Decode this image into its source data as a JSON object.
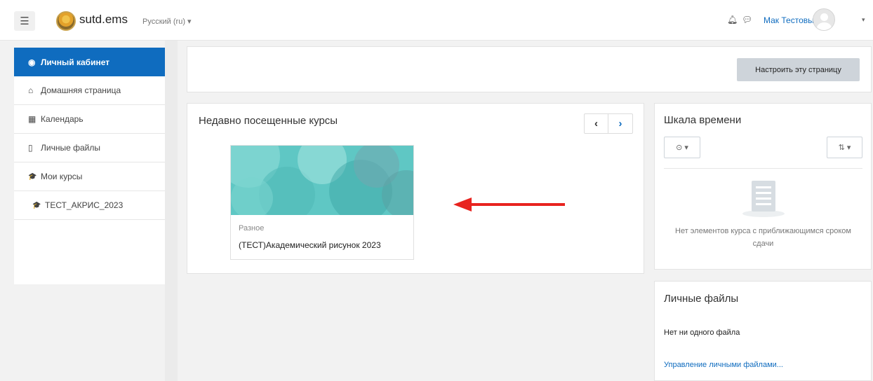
{
  "header": {
    "menu_icon": "hamburger-icon",
    "site_name": "sutd.ems",
    "language": "Русский (ru) ▾",
    "notification_icon": "bell-icon",
    "messages_icon": "chat-icon",
    "user_name": "Мак Тестовый",
    "user_menu_caret": "▾"
  },
  "sidebar": {
    "items": [
      {
        "label": "Личный кабинет",
        "icon": "dashboard-icon",
        "glyph": "◉",
        "active": true
      },
      {
        "label": "Домашняя страница",
        "icon": "home-icon",
        "glyph": "⌂"
      },
      {
        "label": "Календарь",
        "icon": "calendar-icon",
        "glyph": "▦"
      },
      {
        "label": "Личные файлы",
        "icon": "file-icon",
        "glyph": "▯"
      },
      {
        "label": "Мои курсы",
        "icon": "graduation-cap-icon",
        "glyph": "🎓"
      },
      {
        "label": "ТЕСТ_АКРИС_2023",
        "icon": "graduation-cap-icon",
        "glyph": "🎓"
      }
    ]
  },
  "main": {
    "customize_button": "Настроить эту страницу",
    "recent": {
      "title": "Недавно посещенные курсы",
      "prev": "‹",
      "next": "›",
      "course": {
        "category": "Разное",
        "name": "(ТЕСТ)Академический рисунок 2023"
      }
    }
  },
  "timeline": {
    "title": "Шкала времени",
    "filter_button": "⊙ ▾",
    "sort_button": "⇅ ▾",
    "empty_icon": "list-icon",
    "empty_text": "Нет элементов курса с приближающимся сроком сдачи"
  },
  "files": {
    "title": "Личные файлы",
    "empty_text": "Нет ни одного файла",
    "manage_link": "Управление личными файлами..."
  },
  "colors": {
    "accent": "#0f6cbf",
    "annotation_arrow": "#e8231f",
    "course_image": "#5fc7c4"
  }
}
